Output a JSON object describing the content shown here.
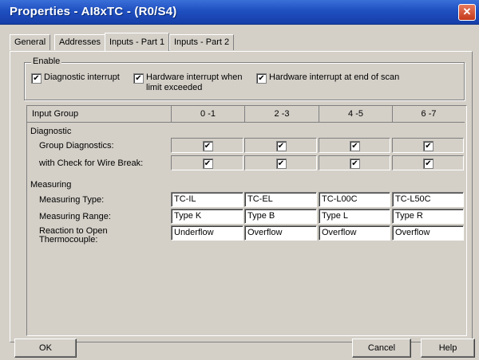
{
  "window": {
    "title": "Properties - AI8xTC - (R0/S4)"
  },
  "tabs": [
    {
      "label": "General"
    },
    {
      "label": "Addresses"
    },
    {
      "label": "Inputs - Part 1"
    },
    {
      "label": "Inputs - Part 2"
    }
  ],
  "enable": {
    "legend": "Enable",
    "items": [
      {
        "label": "Diagnostic interrupt",
        "checked": true
      },
      {
        "label_line1": "Hardware interrupt when",
        "label_line2": "limit exceeded",
        "checked": true
      },
      {
        "label": "Hardware interrupt at end of scan",
        "checked": true
      }
    ]
  },
  "table": {
    "input_group_label": "Input Group",
    "groups": [
      "0 -1",
      "2 -3",
      "4 -5",
      "6 -7"
    ],
    "diagnostic_section": "Diagnostic",
    "group_diagnostics_label": "Group Diagnostics:",
    "group_diagnostics": [
      true,
      true,
      true,
      true
    ],
    "wire_break_label": "with Check for Wire Break:",
    "wire_break": [
      true,
      true,
      true,
      true
    ],
    "measuring_section": "Measuring",
    "measuring_type_label": "Measuring Type:",
    "measuring_type": [
      "TC-IL",
      "TC-EL",
      "TC-L00C",
      "TC-L50C"
    ],
    "measuring_range_label": "Measuring Range:",
    "measuring_range": [
      "Type K",
      "Type B",
      "Type L",
      "Type R"
    ],
    "reaction_label_line1": "Reaction to Open",
    "reaction_label_line2": "Thermocouple:",
    "reaction": [
      "Underflow",
      "Overflow",
      "Overflow",
      "Overflow"
    ]
  },
  "buttons": {
    "ok": "OK",
    "cancel": "Cancel",
    "help": "Help"
  },
  "check_glyph": "✔",
  "colors": {
    "titlebar": "#1f4fc0",
    "dialog_bg": "#d4d0c8",
    "close": "#c4391b"
  }
}
